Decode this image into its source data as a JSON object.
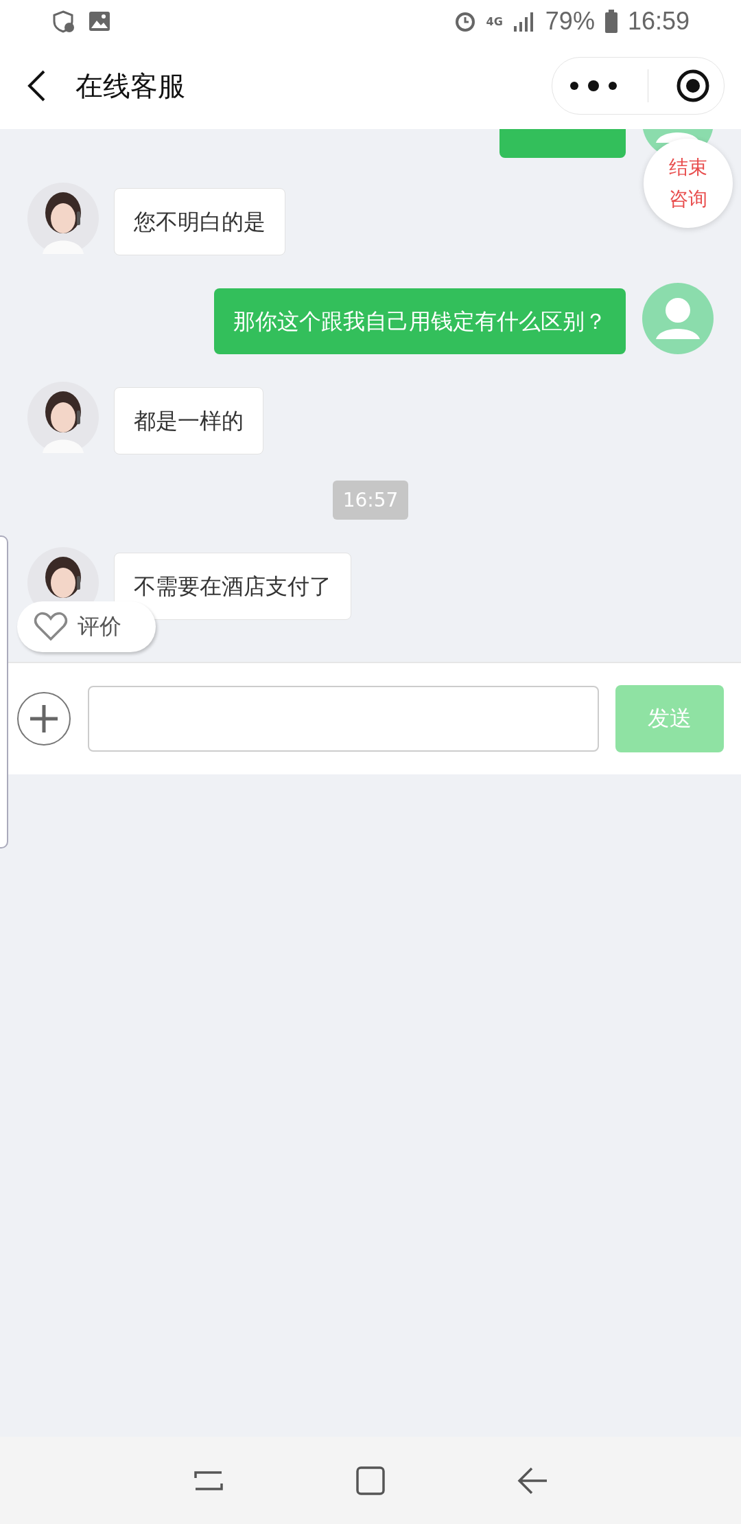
{
  "status_bar": {
    "battery": "79%",
    "time": "16:59",
    "network": "4G"
  },
  "header": {
    "title": "在线客服"
  },
  "end_button": {
    "label": "结束咨询"
  },
  "messages": [
    {
      "kind": "user_cut"
    },
    {
      "kind": "agent",
      "text": "您不明白的是"
    },
    {
      "kind": "user",
      "text": "那你这个跟我自己用钱定有什么区别？"
    },
    {
      "kind": "agent",
      "text": "都是一样的"
    },
    {
      "kind": "time",
      "text": "16:57"
    },
    {
      "kind": "agent",
      "text": "不需要在酒店支付了"
    }
  ],
  "rate_button": {
    "label": "评价"
  },
  "composer": {
    "send": "发送"
  }
}
